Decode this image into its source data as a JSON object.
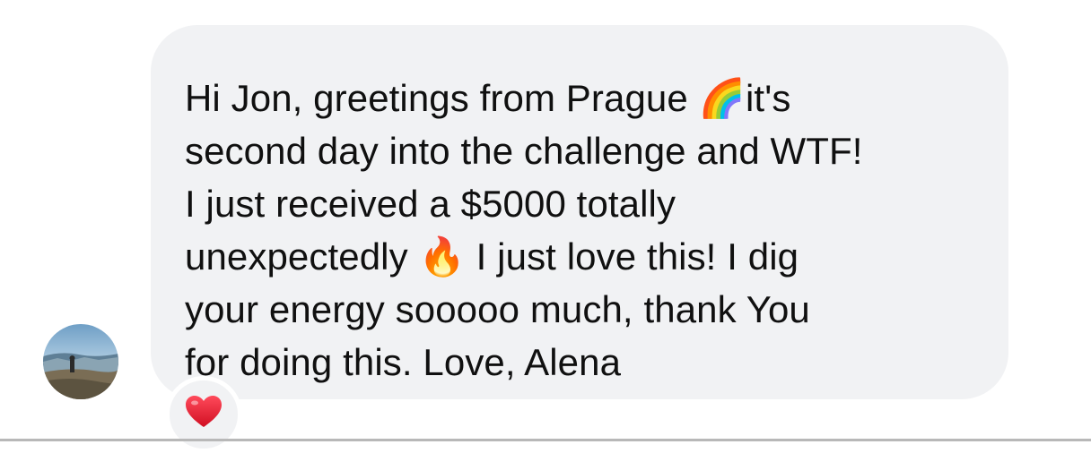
{
  "message": {
    "text": "Hi Jon, greetings from Prague 🌈it's\nsecond day into the challenge and WTF!\nI just received a $5000 totally\nunexpectedly 🔥 I just love this! I dig\nyour energy sooooo much, thank You\nfor doing this. Love, Alena",
    "bubble_color": "#f1f2f4",
    "text_color": "#101010"
  },
  "sender": {
    "avatar_icon": "mountain-photo-avatar"
  },
  "reaction": {
    "emoji": "❤️",
    "icon": "heart-icon",
    "color": "#e3162d"
  }
}
